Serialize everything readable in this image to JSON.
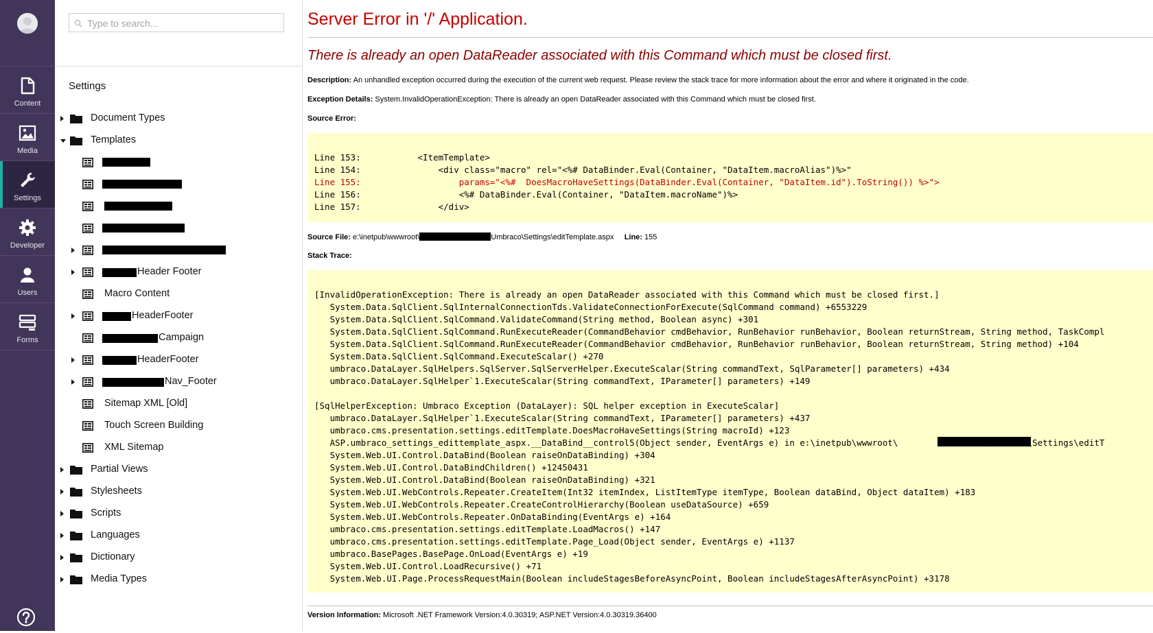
{
  "nav": {
    "items": [
      {
        "label": "Content",
        "icon": "document-icon"
      },
      {
        "label": "Media",
        "icon": "image-icon"
      },
      {
        "label": "Settings",
        "icon": "wrench-icon"
      },
      {
        "label": "Developer",
        "icon": "gear-icon"
      },
      {
        "label": "Users",
        "icon": "user-icon"
      },
      {
        "label": "Forms",
        "icon": "forms-icon"
      }
    ],
    "active": "Settings",
    "accent_color": "#1eb0a4",
    "background_color": "#413659"
  },
  "tree": {
    "search_placeholder": "Type to search...",
    "section_title": "Settings",
    "nodes": [
      {
        "label": "Document Types",
        "type": "folder",
        "expander": "collapsed"
      },
      {
        "label": "Templates",
        "type": "folder",
        "expander": "expanded"
      },
      {
        "label": "",
        "type": "template",
        "redacted": true
      },
      {
        "label": "",
        "type": "template",
        "redacted": true
      },
      {
        "label": "",
        "type": "template",
        "redacted": true
      },
      {
        "label": "",
        "type": "template",
        "redacted": true
      },
      {
        "label": "",
        "type": "template",
        "redacted": true,
        "expander": "collapsed"
      },
      {
        "label": "Header Footer",
        "type": "template",
        "partially_redacted": true,
        "expander": "collapsed"
      },
      {
        "label": "Macro Content",
        "type": "template"
      },
      {
        "label": "HeaderFooter",
        "type": "template",
        "partially_redacted": true,
        "expander": "collapsed"
      },
      {
        "label": "Campaign",
        "type": "template",
        "partially_redacted": true
      },
      {
        "label": "HeaderFooter",
        "type": "template",
        "partially_redacted": true,
        "expander": "collapsed"
      },
      {
        "label": "Nav_Footer",
        "type": "template",
        "partially_redacted": true,
        "expander": "collapsed"
      },
      {
        "label": "Sitemap XML [Old]",
        "type": "template"
      },
      {
        "label": "Touch Screen Building",
        "type": "template"
      },
      {
        "label": "XML Sitemap",
        "type": "template"
      },
      {
        "label": "Partial Views",
        "type": "folder",
        "expander": "collapsed"
      },
      {
        "label": "Stylesheets",
        "type": "folder",
        "expander": "collapsed"
      },
      {
        "label": "Scripts",
        "type": "folder",
        "expander": "collapsed"
      },
      {
        "label": "Languages",
        "type": "folder",
        "expander": "collapsed"
      },
      {
        "label": "Dictionary",
        "type": "folder",
        "expander": "collapsed"
      },
      {
        "label": "Media Types",
        "type": "folder",
        "expander": "collapsed"
      }
    ]
  },
  "error": {
    "title": "Server Error in '/' Application.",
    "message": "There is already an open DataReader associated with this Command which must be closed first.",
    "description_label": "Description:",
    "description_text": "An unhandled exception occurred during the execution of the current web request. Please review the stack trace for more information about the error and where it originated in the code.",
    "exception_label": "Exception Details:",
    "exception_text": "System.InvalidOperationException: There is already an open DataReader associated with this Command which must be closed first.",
    "source_error_label": "Source Error:",
    "source_lines": [
      "Line 153:           <ItemTemplate>",
      "Line 154:               <div class=\"macro\" rel=\"<%# DataBinder.Eval(Container, \"DataItem.macroAlias\")%>\"",
      "Line 155:                   params=\"<%#  DoesMacroHaveSettings(DataBinder.Eval(Container, \"DataItem.id\").ToString()) %>\">",
      "Line 156:                   <%# DataBinder.Eval(Container, \"DataItem.macroName\")%>",
      "Line 157:               </div>"
    ],
    "source_error_line": 155,
    "source_file_label": "Source File:",
    "source_file_prefix": "e:\\inetpub\\wwwroot\\",
    "source_file_suffix": "Umbraco\\Settings\\editTemplate.aspx",
    "line_label": "Line:",
    "line_value": "155",
    "stack_trace_label": "Stack Trace:",
    "stack_block1": [
      "[InvalidOperationException: There is already an open DataReader associated with this Command which must be closed first.]",
      "   System.Data.SqlClient.SqlInternalConnectionTds.ValidateConnectionForExecute(SqlCommand command) +6553229",
      "   System.Data.SqlClient.SqlCommand.ValidateCommand(String method, Boolean async) +301",
      "   System.Data.SqlClient.SqlCommand.RunExecuteReader(CommandBehavior cmdBehavior, RunBehavior runBehavior, Boolean returnStream, String method, TaskCompl",
      "   System.Data.SqlClient.SqlCommand.RunExecuteReader(CommandBehavior cmdBehavior, RunBehavior runBehavior, Boolean returnStream, String method) +104",
      "   System.Data.SqlClient.SqlCommand.ExecuteScalar() +270",
      "   umbraco.DataLayer.SqlHelpers.SqlServer.SqlServerHelper.ExecuteScalar(String commandText, SqlParameter[] parameters) +434",
      "   umbraco.DataLayer.SqlHelper`1.ExecuteScalar(String commandText, IParameter[] parameters) +149"
    ],
    "stack_block2": [
      "[SqlHelperException: Umbraco Exception (DataLayer): SQL helper exception in ExecuteScalar]",
      "   umbraco.DataLayer.SqlHelper`1.ExecuteScalar(String commandText, IParameter[] parameters) +437",
      "   umbraco.cms.presentation.settings.editTemplate.DoesMacroHaveSettings(String macroId) +123",
      "   ASP.umbraco_settings_edittemplate_aspx.__DataBind__control5(Object sender, EventArgs e) in e:\\inetpub\\wwwroot\\                 \\Umbraco\\Settings\\editT",
      "   System.Web.UI.Control.DataBind(Boolean raiseOnDataBinding) +304",
      "   System.Web.UI.Control.DataBindChildren() +12450431",
      "   System.Web.UI.Control.DataBind(Boolean raiseOnDataBinding) +321",
      "   System.Web.UI.WebControls.Repeater.CreateItem(Int32 itemIndex, ListItemType itemType, Boolean dataBind, Object dataItem) +183",
      "   System.Web.UI.WebControls.Repeater.CreateControlHierarchy(Boolean useDataSource) +659",
      "   System.Web.UI.WebControls.Repeater.OnDataBinding(EventArgs e) +164",
      "   umbraco.cms.presentation.settings.editTemplate.LoadMacros() +147",
      "   umbraco.cms.presentation.settings.editTemplate.Page_Load(Object sender, EventArgs e) +1137",
      "   umbraco.BasePages.BasePage.OnLoad(EventArgs e) +19",
      "   System.Web.UI.Control.LoadRecursive() +71",
      "   System.Web.UI.Page.ProcessRequestMain(Boolean includeStagesBeforeAsyncPoint, Boolean includeStagesAfterAsyncPoint) +3178"
    ],
    "version_label": "Version Information:",
    "version_text": "Microsoft .NET Framework Version:4.0.30319; ASP.NET Version:4.0.30319.36400",
    "colors": {
      "title": "#c40000",
      "message": "#8b0000",
      "code_background": "#ffffcc"
    }
  }
}
